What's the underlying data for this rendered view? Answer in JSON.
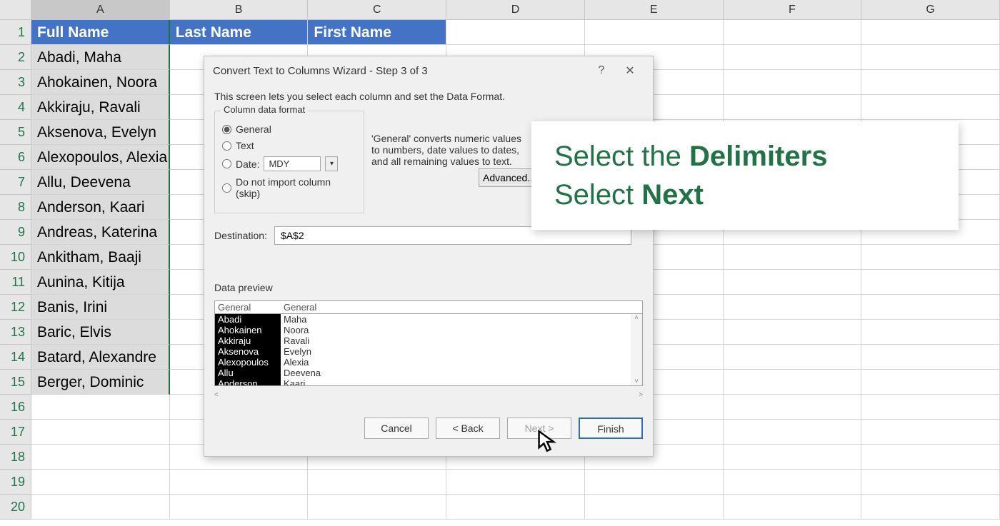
{
  "columns": [
    "A",
    "B",
    "C",
    "D",
    "E",
    "F",
    "G"
  ],
  "rowsVisible": 20,
  "headers": {
    "a": "Full Name",
    "b": "Last Name",
    "c": "First Name"
  },
  "data": [
    "Abadi, Maha",
    "Ahokainen, Noora",
    "Akkiraju, Ravali",
    "Aksenova, Evelyn",
    "Alexopoulos, Alexia",
    "Allu, Deevena",
    "Anderson, Kaari",
    "Andreas, Katerina",
    "Ankitham, Baaji",
    "Aunina, Kitija",
    "Banis, Irini",
    "Baric, Elvis",
    "Batard, Alexandre",
    "Berger, Dominic"
  ],
  "dialog": {
    "title": "Convert Text to Columns Wizard - Step 3 of 3",
    "intro": "This screen lets you select each column and set the Data Format.",
    "formatLegend": "Column data format",
    "radios": {
      "general": "General",
      "text": "Text",
      "date": "Date:",
      "skip": "Do not import column (skip)"
    },
    "dateFmt": "MDY",
    "sideHelp": "'General' converts numeric values to numbers, date values to dates, and all remaining values to text.",
    "advanced": "Advanced...",
    "destLabel": "Destination:",
    "destValue": "$A$2",
    "dpLabel": "Data preview",
    "dpHead": {
      "c1": "General",
      "c2": "General"
    },
    "preview": [
      [
        "Abadi",
        "Maha"
      ],
      [
        "Ahokainen",
        "Noora"
      ],
      [
        "Akkiraju",
        "Ravali"
      ],
      [
        "Aksenova",
        "Evelyn"
      ],
      [
        "Alexopoulos",
        "Alexia"
      ],
      [
        "Allu",
        "Deevena"
      ],
      [
        "Anderson",
        "Kaari"
      ]
    ],
    "buttons": {
      "cancel": "Cancel",
      "back": "< Back",
      "next": "Next >",
      "finish": "Finish"
    }
  },
  "overlay": {
    "line1a": "Select the ",
    "line1b": "Delimiters",
    "line2a": "Select ",
    "line2b": "Next"
  }
}
